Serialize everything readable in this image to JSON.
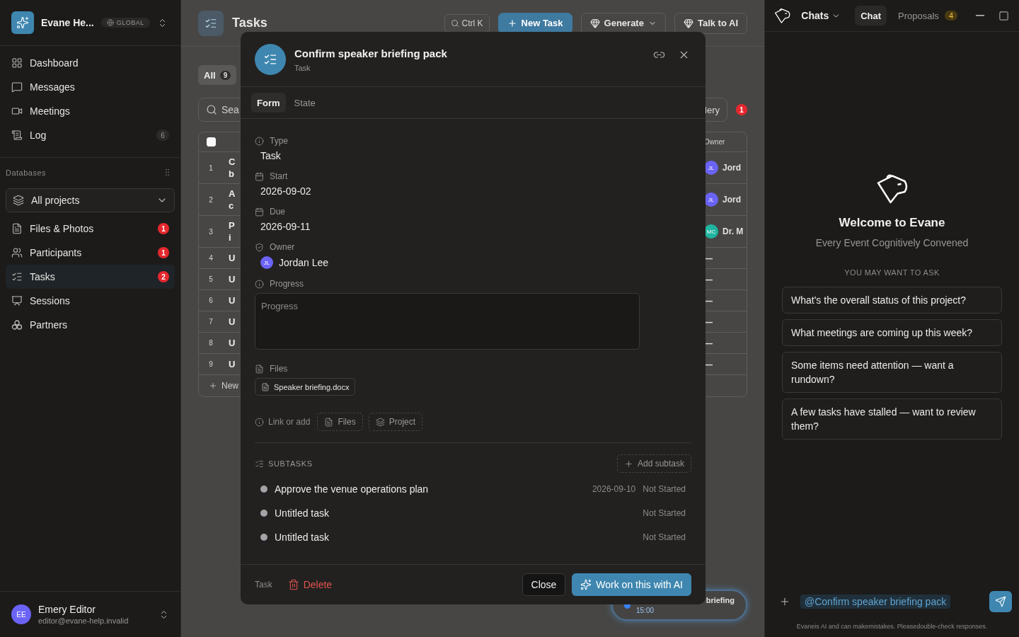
{
  "sidebar": {
    "workspace": {
      "name": "Evane He...",
      "scope": "GLOBAL"
    },
    "nav": [
      {
        "label": "Dashboard",
        "selected": false
      },
      {
        "label": "Messages",
        "selected": false
      },
      {
        "label": "Meetings",
        "selected": false
      },
      {
        "label": "Log",
        "selected": false,
        "count": "6"
      }
    ],
    "databases": {
      "title": "Databases",
      "project_select": "All projects",
      "items": [
        {
          "label": "Files & Photos",
          "badge": "1",
          "selected": false
        },
        {
          "label": "Participants",
          "badge": "1",
          "selected": false
        },
        {
          "label": "Tasks",
          "badge": "2",
          "selected": true
        },
        {
          "label": "Sessions",
          "selected": false
        },
        {
          "label": "Partners",
          "selected": false
        }
      ]
    },
    "user": {
      "initials": "EE",
      "name": "Emery Editor",
      "email": "editor@evane-help.invalid"
    }
  },
  "main": {
    "title": "Tasks",
    "search_hint": "Ctrl K",
    "actions": [
      {
        "label": "New Task",
        "kind": "primary"
      },
      {
        "label": "Generate",
        "kind": "menu"
      },
      {
        "label": "Talk to AI",
        "kind": "ai"
      }
    ],
    "filter_tabs": [
      {
        "label": "All",
        "count": "9",
        "selected": true
      }
    ],
    "search": {
      "placeholder": "Sea"
    },
    "view_button": "lery",
    "alert_count": "1",
    "table": {
      "select_all": {
        "checked": false
      },
      "columns": [
        "Owner"
      ],
      "rows": [
        {
          "number": "1",
          "title_lines": [
            "C",
            "b"
          ],
          "owner": {
            "initials": "JL",
            "name": "Jord",
            "color": "#6b63f5"
          }
        },
        {
          "number": "2",
          "title_lines": [
            "A",
            "c"
          ],
          "owner": {
            "initials": "JL",
            "name": "Jord",
            "color": "#6b63f5"
          }
        },
        {
          "number": "3",
          "title_lines": [
            "P",
            "i"
          ],
          "owner": {
            "initials": "MC",
            "name": "Dr. M",
            "color": "#1fb5a0"
          }
        },
        {
          "number": "4",
          "title_lines": [
            "U"
          ],
          "owner": {
            "name": "—"
          }
        },
        {
          "number": "5",
          "title_lines": [
            "U"
          ],
          "owner": {
            "name": "—"
          }
        },
        {
          "number": "6",
          "title_lines": [
            "U"
          ],
          "owner": {
            "name": "—"
          }
        },
        {
          "number": "7",
          "title_lines": [
            "U"
          ],
          "owner": {
            "name": "—"
          }
        },
        {
          "number": "8",
          "title_lines": [
            "U"
          ],
          "owner": {
            "name": "—"
          }
        },
        {
          "number": "9",
          "title_lines": [
            "U"
          ],
          "owner": {
            "name": "—"
          }
        }
      ],
      "add_row": "New"
    },
    "event_pill": {
      "title": "briefing",
      "time": "15:00"
    }
  },
  "modal": {
    "title": "Confirm speaker briefing pack",
    "subtitle": "Task",
    "tabs": [
      {
        "label": "Form",
        "selected": true
      },
      {
        "label": "State",
        "selected": false
      }
    ],
    "fields": [
      {
        "kind": "text",
        "label": "Type",
        "value": "Task"
      },
      {
        "kind": "date",
        "label": "Start",
        "value": "2026-09-02"
      },
      {
        "kind": "date",
        "label": "Due",
        "value": "2026-09-11"
      },
      {
        "kind": "person",
        "label": "Owner",
        "initials": "JL",
        "value": "Jordan Lee"
      },
      {
        "kind": "textarea",
        "label": "Progress",
        "placeholder": "Progress"
      },
      {
        "kind": "files",
        "label": "Files",
        "files": [
          "Speaker briefing.docx"
        ]
      }
    ],
    "link_row": {
      "label": "Link or add",
      "buttons": [
        "Files",
        "Project"
      ]
    },
    "subtasks": {
      "title": "SUBTASKS",
      "add": "Add subtask",
      "items": [
        {
          "title": "Approve the venue operations plan",
          "due": "2026-09-10",
          "status": "Not Started"
        },
        {
          "title": "Untitled task",
          "status": "Not Started"
        },
        {
          "title": "Untitled task",
          "status": "Not Started"
        }
      ]
    },
    "footer": {
      "type": "Task",
      "delete": "Delete",
      "close": "Close",
      "primary": "Work on this with AI"
    }
  },
  "chat": {
    "menu": "Chats",
    "tabs": [
      {
        "label": "Chat",
        "selected": true
      },
      {
        "label": "Proposals",
        "selected": false,
        "count": "4"
      }
    ],
    "welcome": {
      "title": "Welcome to Evane",
      "tagline": "Every Event Cognitively Convened",
      "prompt_heading": "YOU MAY WANT TO ASK",
      "suggestions": [
        "What's the overall status of this project?",
        "What meetings are coming up this week?",
        "Some items need attention — want a rundown?",
        "A few tasks have stalled — want to review them?"
      ]
    },
    "composer": {
      "mention": "@Confirm speaker briefing pack"
    },
    "disclaimer": "Evaneis AI and can makemistakes. Pleasedouble-check responses."
  }
}
